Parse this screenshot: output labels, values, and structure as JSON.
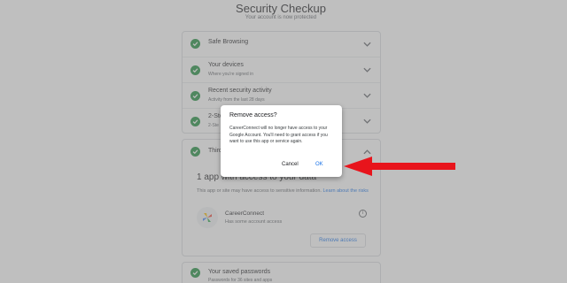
{
  "header": {
    "title": "Security Checkup",
    "subtitle": "Your account is now protected"
  },
  "sections": [
    {
      "label": "Safe Browsing",
      "sub": "",
      "icon": "check-circle-icon",
      "chevron": "down"
    },
    {
      "label": "Your devices",
      "sub": "Where you're signed in",
      "icon": "check-circle-icon",
      "chevron": "down"
    },
    {
      "label": "Recent security activity",
      "sub": "Activity from the last 28 days",
      "icon": "check-circle-icon",
      "chevron": "down"
    },
    {
      "label": "2-Ste",
      "sub": "2-Ste",
      "icon": "check-circle-icon",
      "chevron": "down"
    },
    {
      "label": "Third",
      "sub": "",
      "icon": "check-circle-icon",
      "chevron": "up"
    }
  ],
  "third_party": {
    "heading": "1 app with access to your data",
    "note": "This app or site may have access to sensitive information.",
    "note_link": "Learn about the risks",
    "app_name": "CareerConnect",
    "app_sub": "Has some account access",
    "info_glyph": "i",
    "remove_label": "Remove access"
  },
  "passwords": {
    "label": "Your saved passwords",
    "sub": "Passwords for 36 sites and apps"
  },
  "dialog": {
    "title": "Remove access?",
    "body": "CareerConnect will no longer have access to your Google Account. You'll need to grant access if you want to use this app or service again.",
    "cancel_label": "Cancel",
    "ok_label": "OK"
  },
  "colors": {
    "accent": "#1a73e8",
    "check": "#1e8e3e",
    "arrow": "#e8141c",
    "scrim": "#808080"
  }
}
